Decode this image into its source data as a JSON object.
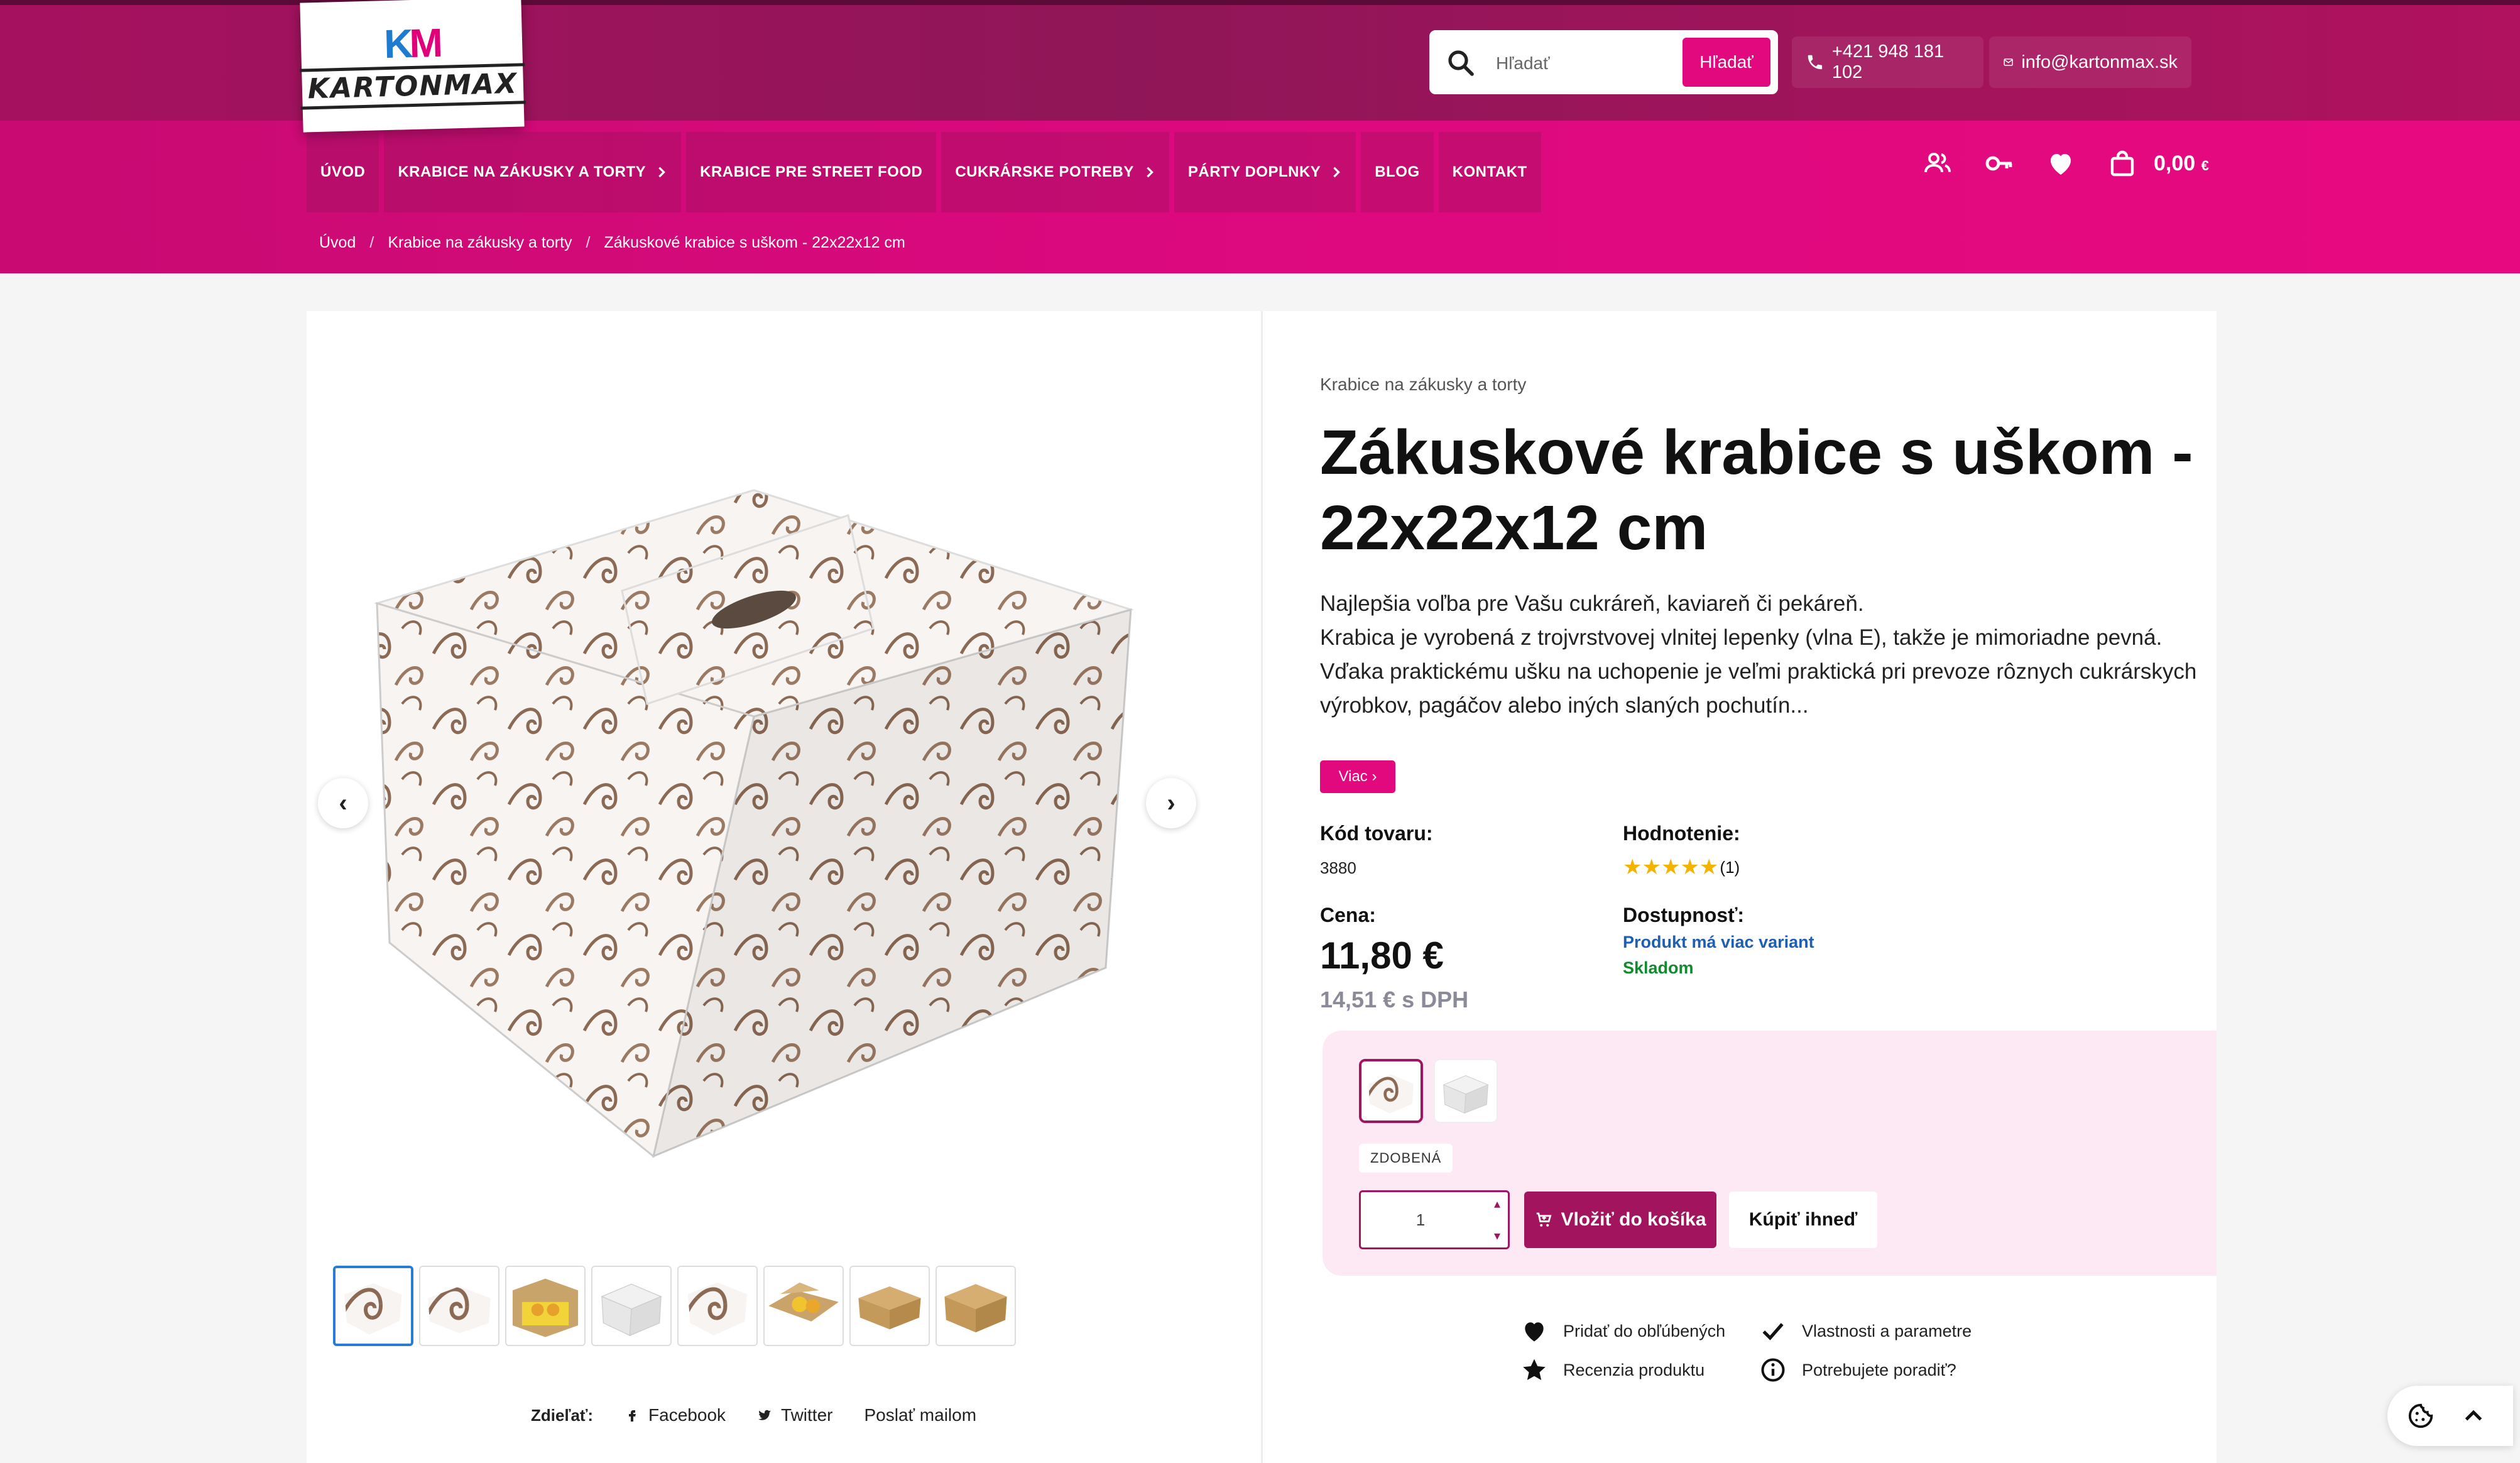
{
  "header": {
    "logo_text": "KARTONMAX",
    "search": {
      "placeholder": "Hľadať",
      "button_label": "Hľadať"
    },
    "phone": "+421 948 181 102",
    "email": "info@kartonmax.sk"
  },
  "nav": {
    "items": [
      {
        "label": "ÚVOD"
      },
      {
        "label": "KRABICE NA ZÁKUSKY A TORTY"
      },
      {
        "label": "KRABICE PRE STREET FOOD"
      },
      {
        "label": "CUKRÁRSKE POTREBY"
      },
      {
        "label": "PÁRTY DOPLNKY"
      },
      {
        "label": "BLOG"
      },
      {
        "label": "KONTAKT"
      }
    ],
    "cart_total": "0,00",
    "cart_currency": "€"
  },
  "breadcrumb": {
    "items": [
      "Úvod",
      "Krabice na zákusky a torty",
      "Zákuskové krabice s uškom - 22x22x12 cm"
    ],
    "separator": "/"
  },
  "gallery": {
    "prev_label": "‹",
    "next_label": "›",
    "thumbnail_count": 8
  },
  "share": {
    "label": "Zdieľať:",
    "facebook": "Facebook",
    "twitter": "Twitter",
    "email": "Poslať mailom"
  },
  "product": {
    "category": "Krabice na zákusky a torty",
    "title": "Zákuskové krabice s uškom - 22x22x12 cm",
    "description_1": "Najlepšia voľba pre Vašu cukráreň, kaviareň či pekáreň.",
    "description_2": "Krabica je vyrobená z trojvrstvovej vlnitej lepenky (vlna E), takže je mimoriadne pevná. Vďaka praktickému ušku na uchopenie je veľmi praktická pri prevoze rôznych cukrárskych výrobkov, pagáčov alebo iných slaných pochutín...",
    "more_label": "Viac ›",
    "code_label": "Kód tovaru:",
    "code": "3880",
    "rating_label": "Hodnotenie:",
    "rating_stars": "★★★★★",
    "rating_count": "(1)",
    "price_label": "Cena:",
    "price": "11,80 €",
    "price_vat": "14,51 € s DPH",
    "availability_label": "Dostupnosť:",
    "availability_variants": "Produkt má viac variant",
    "availability_stock": "Skladom",
    "variant_label": "ZDOBENÁ",
    "quantity": "1",
    "add_to_cart": "Vložiť do košíka",
    "buy_now": "Kúpiť ihneď"
  },
  "actions": {
    "favorite": "Pridať do obľúbených",
    "properties": "Vlastnosti a parametre",
    "review": "Recenzia produktu",
    "advice": "Potrebujete poradiť?"
  },
  "colors": {
    "brand": "#e2097f",
    "brand_dark": "#a3145f",
    "header": "#9a135b",
    "link_blue": "#1d5fb5",
    "stock_green": "#138a2f"
  }
}
